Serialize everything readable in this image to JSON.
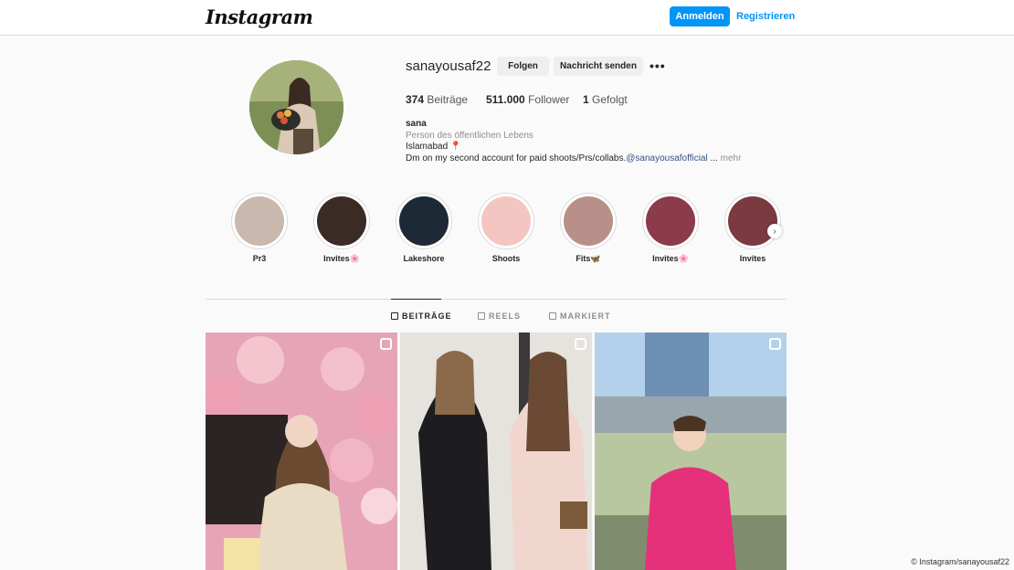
{
  "header": {
    "logo": "Instagram",
    "login_label": "Anmelden",
    "register_label": "Registrieren"
  },
  "profile": {
    "username": "sanayousaf22",
    "follow_label": "Folgen",
    "message_label": "Nachricht senden",
    "more_label": "•••",
    "stats": {
      "posts_count": "374",
      "posts_label": "Beiträge",
      "followers_count": "511.000",
      "followers_label": "Follower",
      "following_count": "1",
      "following_label": "Gefolgt"
    },
    "bio": {
      "name": "sana",
      "category": "Person des öffentlichen Lebens",
      "location": "Islamabad 📍",
      "line": "Dm on my second account for paid shoots/Prs/collabs.",
      "mention": "@sanayousafofficial",
      "ellipsis": "...",
      "more": "mehr"
    }
  },
  "highlights": [
    {
      "label": "Pr3",
      "color": "#c9b8ae"
    },
    {
      "label": "Invites🌸",
      "color": "#3a2c25"
    },
    {
      "label": "Lakeshore",
      "color": "#1d2a35"
    },
    {
      "label": "Shoots",
      "color": "#f3c6c2"
    },
    {
      "label": "Fits🦋",
      "color": "#b89089"
    },
    {
      "label": "Invites🌸",
      "color": "#8b3b4a"
    },
    {
      "label": "Invites",
      "color": "#7a3a40"
    }
  ],
  "tabs": [
    {
      "label": "BEITRÄGE",
      "active": true
    },
    {
      "label": "REELS",
      "active": false
    },
    {
      "label": "MARKIERT",
      "active": false
    }
  ],
  "posts": [
    {
      "type": "reel",
      "bg": "#e9a9b8"
    },
    {
      "type": "reel",
      "bg": "#d9d2cd"
    },
    {
      "type": "reel",
      "bg": "#9fc0dc"
    }
  ],
  "credit": "© Instagram/sanayousaf22"
}
